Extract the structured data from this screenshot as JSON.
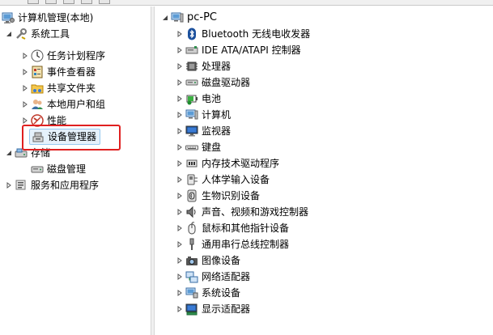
{
  "left_tree": {
    "root": "计算机管理(本地)",
    "system_tools": "系统工具",
    "task_scheduler": "任务计划程序",
    "event_viewer": "事件查看器",
    "shared_folders": "共享文件夹",
    "local_users": "本地用户和组",
    "performance": "性能",
    "device_manager": "设备管理器",
    "storage": "存储",
    "disk_management": "磁盘管理",
    "services_apps": "服务和应用程序"
  },
  "right_tree": {
    "root": "pc-PC",
    "items": [
      {
        "label": "Bluetooth 无线电收发器",
        "icon": "bluetooth-icon"
      },
      {
        "label": "IDE ATA/ATAPI 控制器",
        "icon": "ide-controller-icon"
      },
      {
        "label": "处理器",
        "icon": "processor-icon"
      },
      {
        "label": "磁盘驱动器",
        "icon": "disk-drive-icon"
      },
      {
        "label": "电池",
        "icon": "battery-icon"
      },
      {
        "label": "计算机",
        "icon": "computer-icon"
      },
      {
        "label": "监视器",
        "icon": "monitor-icon"
      },
      {
        "label": "键盘",
        "icon": "keyboard-icon"
      },
      {
        "label": "内存技术驱动程序",
        "icon": "memory-driver-icon"
      },
      {
        "label": "人体学输入设备",
        "icon": "hid-icon"
      },
      {
        "label": "生物识别设备",
        "icon": "biometric-icon"
      },
      {
        "label": "声音、视频和游戏控制器",
        "icon": "sound-icon"
      },
      {
        "label": "鼠标和其他指针设备",
        "icon": "mouse-icon"
      },
      {
        "label": "通用串行总线控制器",
        "icon": "usb-icon"
      },
      {
        "label": "图像设备",
        "icon": "imaging-icon"
      },
      {
        "label": "网络适配器",
        "icon": "network-adapter-icon"
      },
      {
        "label": "系统设备",
        "icon": "system-device-icon"
      },
      {
        "label": "显示适配器",
        "icon": "display-adapter-icon"
      }
    ]
  },
  "colors": {
    "selection_bg": "#e5f1fb",
    "selection_border": "#99c9ef",
    "highlight": "#e02020"
  }
}
